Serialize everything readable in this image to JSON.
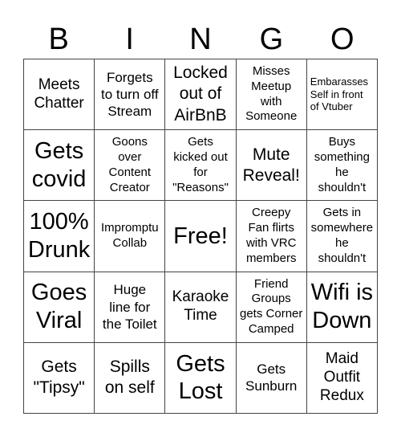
{
  "header": {
    "letters": [
      "B",
      "I",
      "N",
      "G",
      "O"
    ]
  },
  "board": {
    "cells": [
      "Meets\nChatter",
      "Forgets\nto turn off\nStream",
      "Locked\nout of\nAirBnB",
      "Misses\nMeetup\nwith\nSomeone",
      "Embarasses\nSelf in front\nof Vtuber",
      "Gets\ncovid",
      "Goons\nover\nContent\nCreator",
      "Gets\nkicked out\nfor\n\"Reasons\"",
      "Mute\nReveal!",
      "Buys\nsomething\nhe\nshouldn't",
      "100%\nDrunk",
      "Impromptu\nCollab",
      "Free!",
      "Creepy\nFan flirts\nwith VRC\nmembers",
      "Gets in\nsomewhere\nhe\nshouldn't",
      "Goes\nViral",
      "Huge\nline for\nthe Toilet",
      "Karaoke\nTime",
      "Friend\nGroups\ngets Corner\nCamped",
      "Wifi is\nDown",
      "Gets\n\"Tipsy\"",
      "Spills\non self",
      "Gets\nLost",
      "Gets\nSunburn",
      "Maid\nOutfit\nRedux"
    ]
  }
}
